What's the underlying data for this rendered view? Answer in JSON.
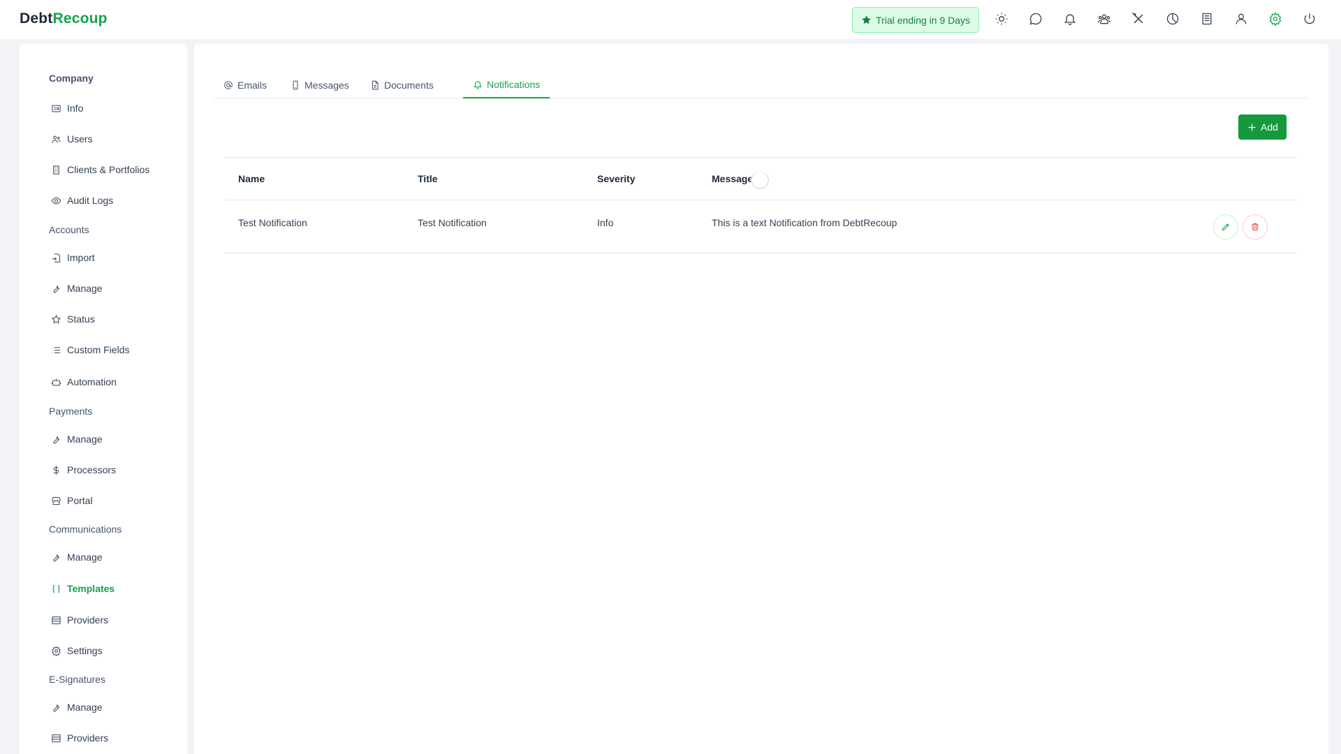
{
  "app": {
    "logo_part1": "Debt",
    "logo_part2": "Recoup"
  },
  "header": {
    "trial_badge": "Trial ending in 9 Days",
    "icons": [
      "sun-icon",
      "chat-icon",
      "bell-icon",
      "users-group-icon",
      "tools-icon",
      "pie-chart-icon",
      "ledger-icon",
      "user-icon",
      "gear-icon",
      "power-icon"
    ]
  },
  "sidebar": {
    "sections": [
      {
        "label": "Company",
        "items": [
          {
            "label": "Info",
            "icon": "id-card-icon"
          },
          {
            "label": "Users",
            "icon": "users-icon"
          },
          {
            "label": "Clients & Portfolios",
            "icon": "building-icon"
          },
          {
            "label": "Audit Logs",
            "icon": "eye-icon"
          }
        ]
      },
      {
        "label": "Accounts",
        "items": [
          {
            "label": "Import",
            "icon": "import-icon"
          },
          {
            "label": "Manage",
            "icon": "wrench-icon"
          },
          {
            "label": "Status",
            "icon": "star-icon"
          },
          {
            "label": "Custom Fields",
            "icon": "list-icon"
          },
          {
            "label": "Automation",
            "icon": "robot-icon"
          }
        ]
      },
      {
        "label": "Payments",
        "items": [
          {
            "label": "Manage",
            "icon": "wrench-icon"
          },
          {
            "label": "Processors",
            "icon": "dollar-icon"
          },
          {
            "label": "Portal",
            "icon": "storefront-icon"
          }
        ]
      },
      {
        "label": "Communications",
        "items": [
          {
            "label": "Manage",
            "icon": "wrench-icon"
          },
          {
            "label": "Templates",
            "icon": "braces-icon",
            "active": true
          },
          {
            "label": "Providers",
            "icon": "server-icon"
          },
          {
            "label": "Settings",
            "icon": "gear-icon"
          }
        ]
      },
      {
        "label": "E-Signatures",
        "items": [
          {
            "label": "Manage",
            "icon": "wrench-icon"
          },
          {
            "label": "Providers",
            "icon": "server-icon"
          }
        ]
      }
    ]
  },
  "tabs": [
    {
      "label": "Emails",
      "icon": "at-icon"
    },
    {
      "label": "Messages",
      "icon": "phone-icon"
    },
    {
      "label": "Documents",
      "icon": "file-icon"
    },
    {
      "label": "Notifications",
      "icon": "bell-icon",
      "active": true
    }
  ],
  "toolbar": {
    "add_label": "Add"
  },
  "table": {
    "columns": [
      "Name",
      "Title",
      "Severity",
      "Message"
    ],
    "rows": [
      {
        "name": "Test Notification",
        "title": "Test Notification",
        "severity": "Info",
        "message": "This is a text Notification from DebtRecoup"
      }
    ]
  },
  "colors": {
    "accent": "#16a34a",
    "danger": "#ef4444",
    "trial_bg": "#dcfce7"
  }
}
